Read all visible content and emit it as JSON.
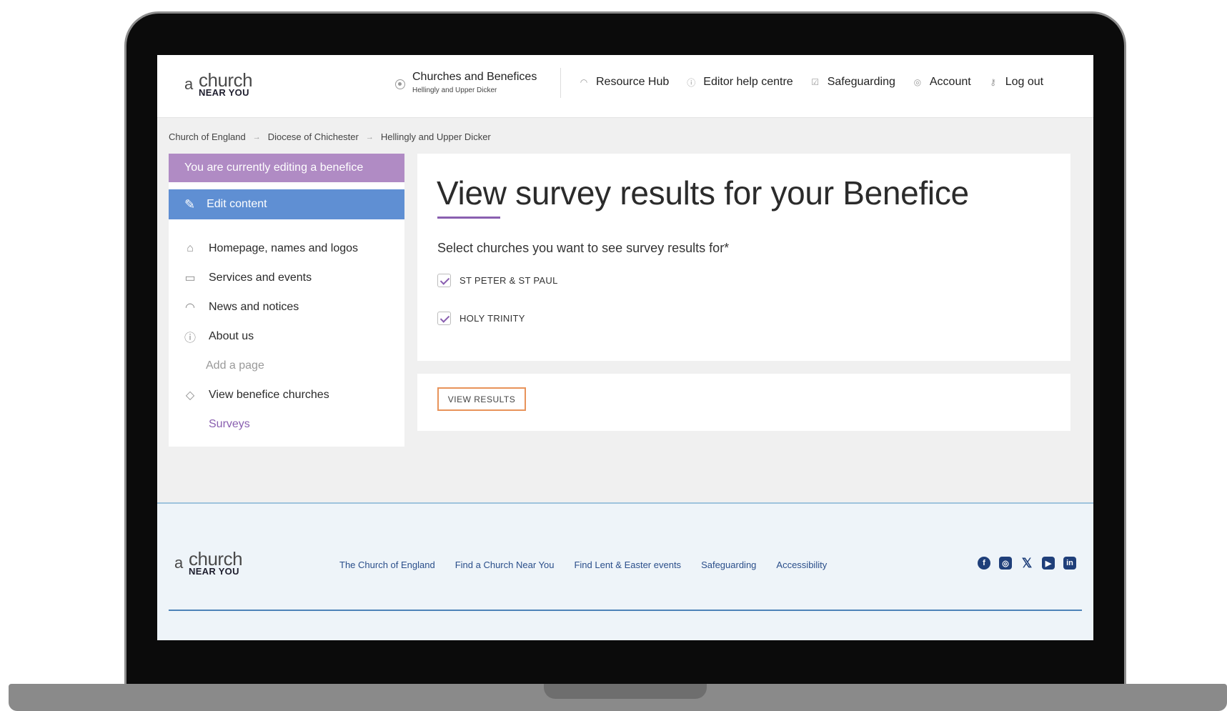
{
  "logo": {
    "a": "a",
    "church": "church",
    "near_you": "NEAR YOU"
  },
  "header": {
    "benefice_title": "Churches and Benefices",
    "benefice_subtitle": "Hellingly and Upper Dicker",
    "nav": [
      {
        "label": "Resource Hub",
        "icon": "broadcast-icon"
      },
      {
        "label": "Editor help centre",
        "icon": "help-icon"
      },
      {
        "label": "Safeguarding",
        "icon": "checkbox-icon"
      },
      {
        "label": "Account",
        "icon": "account-icon"
      },
      {
        "label": "Log out",
        "icon": "key-icon"
      }
    ]
  },
  "breadcrumb": [
    "Church of England",
    "Diocese of Chichester",
    "Hellingly and Upper Dicker"
  ],
  "sidebar": {
    "editing_banner": "You are currently editing a benefice",
    "edit_content": "Edit content",
    "items": [
      {
        "label": "Homepage, names and logos",
        "icon": "home-icon"
      },
      {
        "label": "Services and events",
        "icon": "calendar-icon"
      },
      {
        "label": "News and notices",
        "icon": "broadcast-icon"
      },
      {
        "label": "About us",
        "icon": "info-icon"
      },
      {
        "label": "Add a page"
      },
      {
        "label": "View benefice churches",
        "icon": "diamond-icon"
      },
      {
        "label": "Surveys"
      }
    ]
  },
  "main": {
    "title": "View survey results for your Benefice",
    "select_label": "Select churches you want to see survey results for*",
    "churches": [
      {
        "label": "ST PETER & ST PAUL",
        "checked": true
      },
      {
        "label": "HOLY TRINITY",
        "checked": true
      }
    ],
    "view_results": "VIEW RESULTS"
  },
  "footer": {
    "links": [
      "The Church of England",
      "Find a Church Near You",
      "Find Lent & Easter events",
      "Safeguarding",
      "Accessibility"
    ],
    "social": [
      "facebook-icon",
      "instagram-icon",
      "x-icon",
      "youtube-icon",
      "linkedin-icon"
    ]
  },
  "colors": {
    "purple": "#8a5fb0",
    "banner_purple": "#b08bc4",
    "edit_blue": "#5f8fd3",
    "button_orange": "#e8935a",
    "footer_link": "#2a4e8a"
  }
}
